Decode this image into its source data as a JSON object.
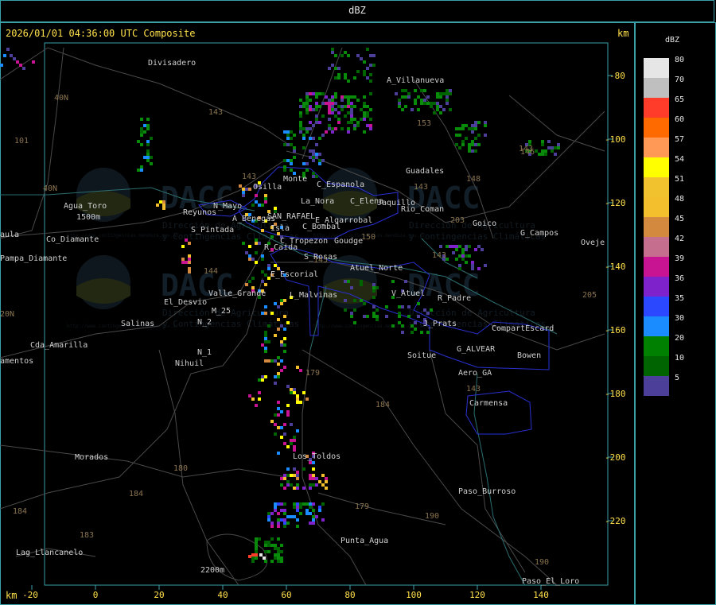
{
  "header": {
    "title": "dBZ"
  },
  "map": {
    "timestamp": "2026/01/01 04:36:00 UTC Composite",
    "unit_top": "km",
    "unit_bottom": "km",
    "y_ticks": [
      "-80",
      "-100",
      "-120",
      "-140",
      "-160",
      "-180",
      "-200",
      "-220"
    ],
    "x_ticks": [
      "-20",
      "0",
      "20",
      "40",
      "60",
      "80",
      "100",
      "120",
      "140"
    ],
    "place_labels": [
      {
        "name": "Divisadero"
      },
      {
        "name": "A_Villanueva"
      },
      {
        "name": "Guadales"
      },
      {
        "name": "Agua_Toro"
      },
      {
        "name": "1500m"
      },
      {
        "name": "aula"
      },
      {
        "name": "Co_Diamante"
      },
      {
        "name": "Pampa_Diamante"
      },
      {
        "name": "Reyunos"
      },
      {
        "name": "S_Pintada"
      },
      {
        "name": "Osilla"
      },
      {
        "name": "Monte"
      },
      {
        "name": "C_Espanola"
      },
      {
        "name": "La_Nora"
      },
      {
        "name": "C_Elena"
      },
      {
        "name": "Jaquillo"
      },
      {
        "name": "Rio_Coman"
      },
      {
        "name": "Goico"
      },
      {
        "name": "G_Campos"
      },
      {
        "name": "Oveje"
      },
      {
        "name": "N_Mayo"
      },
      {
        "name": "A_Benegas"
      },
      {
        "name": "SAN_RAFAEL"
      },
      {
        "name": "C_Bombal"
      },
      {
        "name": "E_Algarrobal"
      },
      {
        "name": "Isla"
      },
      {
        "name": "C_Tropezon"
      },
      {
        "name": "Goudge"
      },
      {
        "name": "R_Caida"
      },
      {
        "name": "S_Rosas"
      },
      {
        "name": "Atuel_Norte"
      },
      {
        "name": "E_Escorial"
      },
      {
        "name": "Valle_Grande"
      },
      {
        "name": "L_Malvinas"
      },
      {
        "name": "V_Atuel"
      },
      {
        "name": "R_Padre"
      },
      {
        "name": "El_Desvio"
      },
      {
        "name": "Salinas"
      },
      {
        "name": "M_25"
      },
      {
        "name": "N_2"
      },
      {
        "name": "J_Prats"
      },
      {
        "name": "CompartEscard"
      },
      {
        "name": "G_ALVEAR"
      },
      {
        "name": "Bowen"
      },
      {
        "name": "Soitue"
      },
      {
        "name": "Aero_GA"
      },
      {
        "name": "Cda_Amarilla"
      },
      {
        "name": "amentos"
      },
      {
        "name": "N_1"
      },
      {
        "name": "Nihuil"
      },
      {
        "name": "Carmensa"
      },
      {
        "name": "Morados"
      },
      {
        "name": "Los_Toldos"
      },
      {
        "name": "Paso_Burroso"
      },
      {
        "name": "Lag_Llancanelo"
      },
      {
        "name": "Punta_Agua"
      },
      {
        "name": "2200m"
      },
      {
        "name": "Paso_El_Loro"
      }
    ],
    "route_labels": [
      "143",
      "101",
      "40N",
      "40N",
      "153",
      "143",
      "146",
      "148",
      "143",
      "203",
      "144",
      "145",
      "179",
      "184",
      "180",
      "184",
      "183",
      "184",
      "179",
      "190",
      "143",
      "205",
      "143",
      "143",
      "150",
      "190",
      "20N"
    ],
    "watermark": {
      "brand": "DACC",
      "line1": "Dirección de Agricultura",
      "line2": "y Contingencias Climáticas",
      "url": "http://www.contingencias.mendoza.gov.ar"
    }
  },
  "legend": {
    "title": "dBZ",
    "levels": [
      {
        "value": "80",
        "color": "#e6e6e6"
      },
      {
        "value": "70",
        "color": "#bfbfbf"
      },
      {
        "value": "65",
        "color": "#ff3b2a"
      },
      {
        "value": "60",
        "color": "#ff6a00"
      },
      {
        "value": "57",
        "color": "#ff9955"
      },
      {
        "value": "54",
        "color": "#ffff00"
      },
      {
        "value": "51",
        "color": "#f2c12e"
      },
      {
        "value": "48",
        "color": "#f3bf2c"
      },
      {
        "value": "45",
        "color": "#d48a3e"
      },
      {
        "value": "42",
        "color": "#c66e8e"
      },
      {
        "value": "39",
        "color": "#c81493"
      },
      {
        "value": "36",
        "color": "#7e22cc"
      },
      {
        "value": "35",
        "color": "#2b48ff"
      },
      {
        "value": "30",
        "color": "#1a8cff"
      },
      {
        "value": "20",
        "color": "#008000"
      },
      {
        "value": "10",
        "color": "#006400"
      },
      {
        "value": "5",
        "color": "#4b3f9a"
      }
    ]
  }
}
